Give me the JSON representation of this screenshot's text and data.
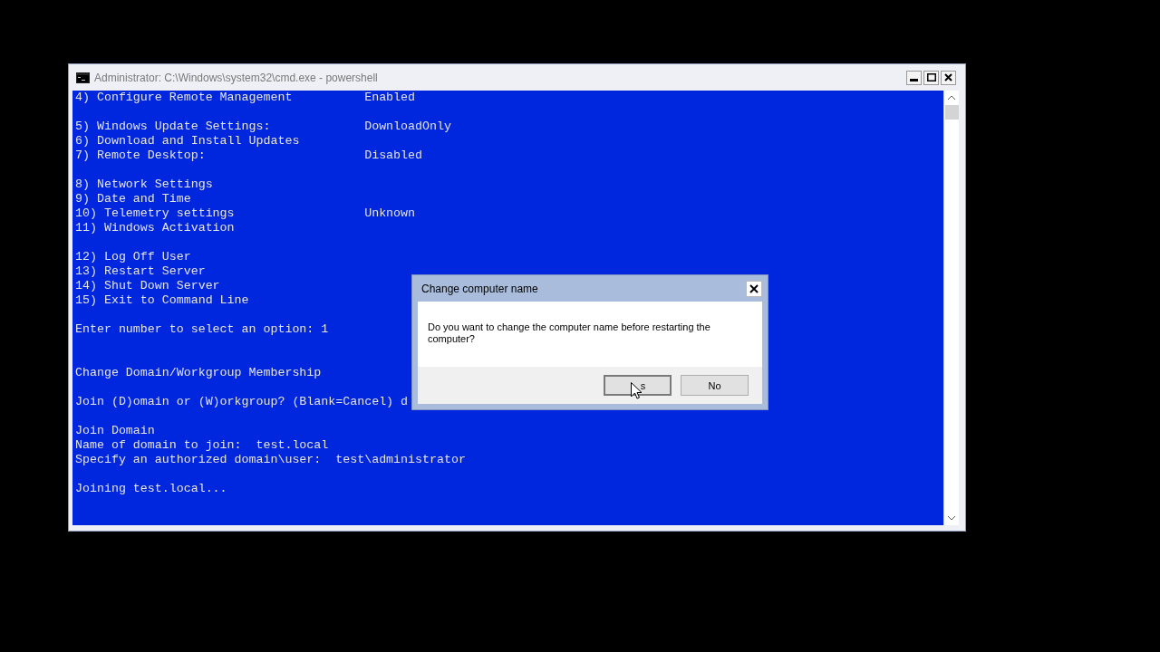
{
  "window": {
    "title": "Administrator: C:\\Windows\\system32\\cmd.exe - powershell"
  },
  "console": {
    "lines": [
      {
        "kind": "text",
        "text": "4) Configure Remote Management",
        "value": "Enabled"
      },
      {
        "kind": "blank"
      },
      {
        "kind": "text",
        "text": "5) Windows Update Settings:",
        "value": "DownloadOnly"
      },
      {
        "kind": "text",
        "text": "6) Download and Install Updates"
      },
      {
        "kind": "text",
        "text": "7) Remote Desktop:",
        "value": "Disabled"
      },
      {
        "kind": "blank"
      },
      {
        "kind": "text",
        "text": "8) Network Settings"
      },
      {
        "kind": "text",
        "text": "9) Date and Time"
      },
      {
        "kind": "text",
        "text": "10) Telemetry settings",
        "value": "Unknown"
      },
      {
        "kind": "text",
        "text": "11) Windows Activation"
      },
      {
        "kind": "blank"
      },
      {
        "kind": "text",
        "text": "12) Log Off User"
      },
      {
        "kind": "text",
        "text": "13) Restart Server"
      },
      {
        "kind": "text",
        "text": "14) Shut Down Server"
      },
      {
        "kind": "text",
        "text": "15) Exit to Command Line"
      },
      {
        "kind": "blank"
      },
      {
        "kind": "text",
        "text": "Enter number to select an option: 1"
      },
      {
        "kind": "blank"
      },
      {
        "kind": "blank"
      },
      {
        "kind": "text",
        "text": "Change Domain/Workgroup Membership"
      },
      {
        "kind": "blank"
      },
      {
        "kind": "text",
        "text": "Join (D)omain or (W)orkgroup? (Blank=Cancel) d"
      },
      {
        "kind": "blank"
      },
      {
        "kind": "text",
        "text": "Join Domain"
      },
      {
        "kind": "text",
        "text": "Name of domain to join:  test.local"
      },
      {
        "kind": "text",
        "text": "Specify an authorized domain\\user:  test\\administrator"
      },
      {
        "kind": "blank"
      },
      {
        "kind": "text",
        "text": "Joining test.local..."
      }
    ]
  },
  "dialog": {
    "title": "Change computer name",
    "message": "Do you want to change the computer name before restarting the computer?",
    "buttons": [
      {
        "label": "s",
        "focused": true
      },
      {
        "label": "No",
        "focused": false
      }
    ]
  }
}
